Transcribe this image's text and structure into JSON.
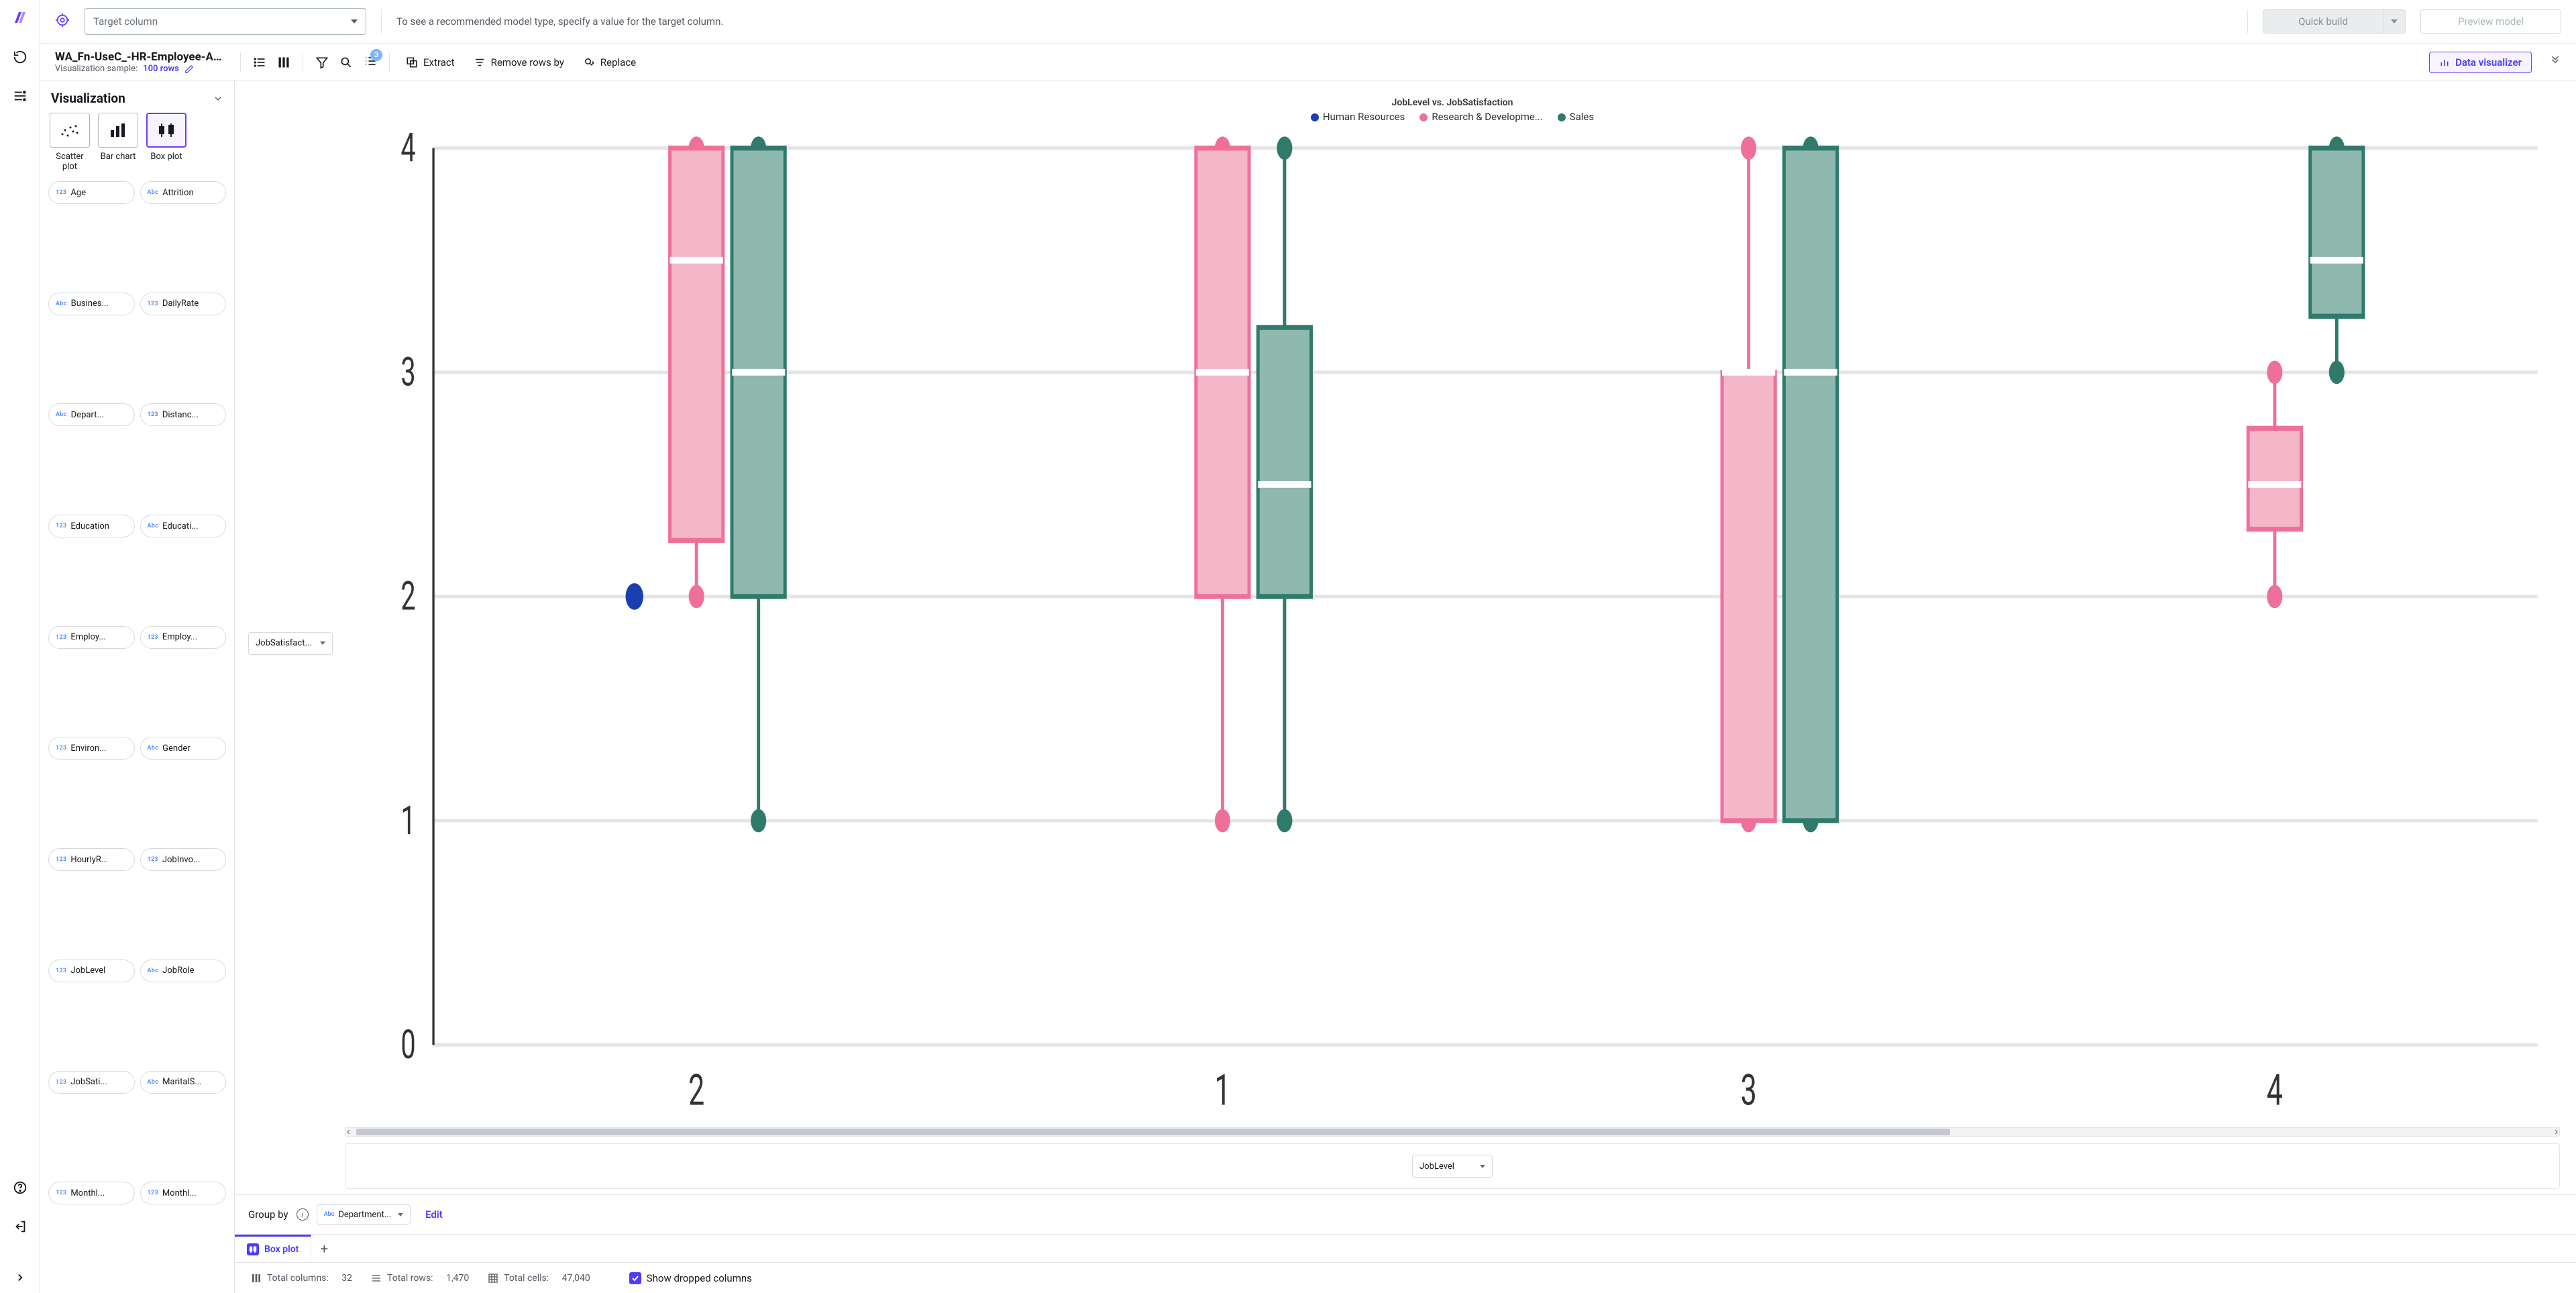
{
  "topbar": {
    "target_placeholder": "Target column",
    "hint": "To see a recommended model type, specify a value for the target column.",
    "quick_build": "Quick build",
    "preview_model": "Preview model"
  },
  "secondbar": {
    "dataset_name": "WA_Fn-UseC_-HR-Employee-Attrition...",
    "vis_sample_label": "Visualization sample:",
    "vis_rows": "100 rows",
    "badge": "3",
    "extract": "Extract",
    "remove_rows": "Remove rows by",
    "replace": "Replace",
    "data_visualizer": "Data visualizer"
  },
  "sidepanel": {
    "title": "Visualization",
    "types": {
      "scatter": "Scatter plot",
      "bar": "Bar chart",
      "box": "Box plot"
    },
    "columns": [
      {
        "dt": "123",
        "name": "Age"
      },
      {
        "dt": "Abc",
        "name": "Attrition"
      },
      {
        "dt": "Abc",
        "name": "Busines..."
      },
      {
        "dt": "123",
        "name": "DailyRate"
      },
      {
        "dt": "Abc",
        "name": "Depart..."
      },
      {
        "dt": "123",
        "name": "Distanc..."
      },
      {
        "dt": "123",
        "name": "Education"
      },
      {
        "dt": "Abc",
        "name": "Educati..."
      },
      {
        "dt": "123",
        "name": "Employ..."
      },
      {
        "dt": "123",
        "name": "Employ..."
      },
      {
        "dt": "123",
        "name": "Environ..."
      },
      {
        "dt": "Abc",
        "name": "Gender"
      },
      {
        "dt": "123",
        "name": "HourlyR..."
      },
      {
        "dt": "123",
        "name": "JobInvo..."
      },
      {
        "dt": "123",
        "name": "JobLevel"
      },
      {
        "dt": "Abc",
        "name": "JobRole"
      },
      {
        "dt": "123",
        "name": "JobSati..."
      },
      {
        "dt": "Abc",
        "name": "MaritalS..."
      },
      {
        "dt": "123",
        "name": "Monthl..."
      },
      {
        "dt": "123",
        "name": "Monthl..."
      }
    ]
  },
  "dropzones": {
    "y": "JobSatisfact...",
    "x": "JobLevel",
    "group": "Department..."
  },
  "groupby": {
    "label": "Group by",
    "edit": "Edit"
  },
  "tab": {
    "name": "Box plot"
  },
  "statusbar": {
    "cols_label": "Total columns:",
    "cols": "32",
    "rows_label": "Total rows:",
    "rows": "1,470",
    "cells_label": "Total cells:",
    "cells": "47,040",
    "show_dropped": "Show dropped columns"
  },
  "chart_data": {
    "type": "boxplot",
    "title": "JobLevel vs. JobSatisfaction",
    "xlabel": "JobLevel",
    "ylabel": "JobSatisfaction",
    "ylim": [
      0,
      4
    ],
    "yticks": [
      0,
      1,
      2,
      3,
      4
    ],
    "categories": [
      "2",
      "1",
      "3",
      "4"
    ],
    "legend": [
      {
        "name": "Human Resources",
        "color": "#1a3fb3"
      },
      {
        "name": "Research & Developme...",
        "color": "#ee7098"
      },
      {
        "name": "Sales",
        "color": "#2f7a6b"
      }
    ],
    "series": [
      {
        "name": "Human Resources",
        "color": "#1a3fb3",
        "boxes": [
          {
            "cat": "2",
            "min": 2,
            "q1": 2,
            "median": 2,
            "q3": 2,
            "max": 2,
            "point_only": true
          }
        ]
      },
      {
        "name": "Research & Development",
        "color": "#ee7098",
        "fill": "#f4b6c9",
        "boxes": [
          {
            "cat": "2",
            "min": 2,
            "q1": 2.25,
            "median": 3.5,
            "q3": 4,
            "max": 4
          },
          {
            "cat": "1",
            "min": 1,
            "q1": 2,
            "median": 3,
            "q3": 4,
            "max": 4
          },
          {
            "cat": "3",
            "min": 1,
            "q1": 1,
            "median": 3,
            "q3": 3,
            "max": 4
          },
          {
            "cat": "4",
            "min": 2,
            "q1": 2.3,
            "median": 2.5,
            "q3": 2.75,
            "max": 3
          }
        ]
      },
      {
        "name": "Sales",
        "color": "#2f7a6b",
        "fill": "#8fb8af",
        "boxes": [
          {
            "cat": "2",
            "min": 1,
            "q1": 2,
            "median": 3,
            "q3": 4,
            "max": 4
          },
          {
            "cat": "1",
            "min": 1,
            "q1": 2,
            "median": 2.5,
            "q3": 3.2,
            "max": 4
          },
          {
            "cat": "3",
            "min": 1,
            "q1": 1,
            "median": 3,
            "q3": 4,
            "max": 4
          },
          {
            "cat": "4",
            "min": 3,
            "q1": 3.25,
            "median": 3.5,
            "q3": 4,
            "max": 4
          }
        ]
      }
    ]
  }
}
